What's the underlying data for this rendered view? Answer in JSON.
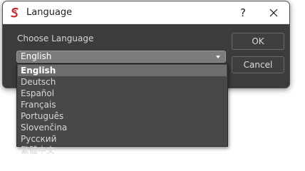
{
  "window": {
    "title": "Language",
    "help_glyph": "?",
    "close_glyph": "✕"
  },
  "dialog": {
    "choose_label": "Choose Language",
    "selected_value": "English",
    "ok_label": "OK",
    "cancel_label": "Cancel"
  },
  "dropdown": {
    "options": [
      "English",
      "Deutsch",
      "Español",
      "Français",
      "Português",
      "Slovenčina",
      "Русский",
      "繁體中文"
    ],
    "highlighted_index": 0
  },
  "colors": {
    "accent_icon": "#c62828",
    "dialog_bg": "#3c3c3c",
    "highlight": "#6e6e6e"
  },
  "icons": {
    "app": "app-logo-icon",
    "help": "help-icon",
    "close": "close-icon",
    "combo": "chevron-down-icon"
  }
}
